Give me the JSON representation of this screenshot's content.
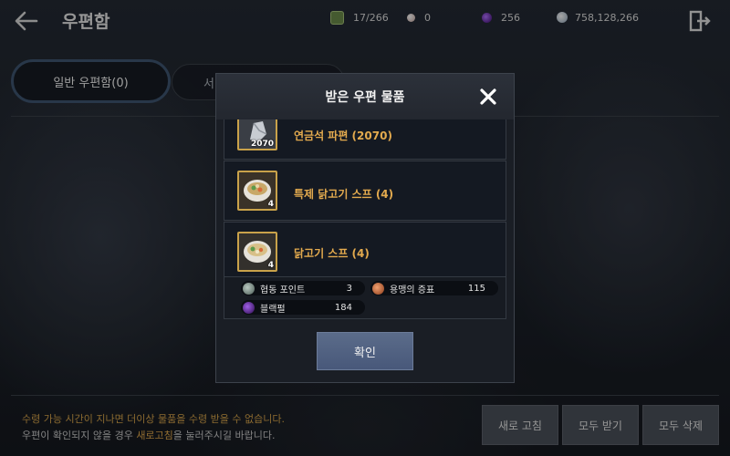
{
  "header": {
    "title": "우편함",
    "currencies": [
      {
        "icon": "coin-icon",
        "value": "17/266"
      },
      {
        "icon": "pearl-icon",
        "value": "0"
      },
      {
        "icon": "purple-orb-icon",
        "value": "256"
      },
      {
        "icon": "silver-icon",
        "value": "758,128,266"
      }
    ]
  },
  "tabs": [
    {
      "label": "일반 우편함(0)",
      "active": true
    },
    {
      "label": "서"
    }
  ],
  "modal": {
    "title": "받은 우편 물품",
    "items": [
      {
        "name": "연금석 파편 (2070)",
        "qty": "2070",
        "icon": "alchemy-stone-shard-icon"
      },
      {
        "name": "특제 닭고기 스프 (4)",
        "qty": "4",
        "icon": "soup-bowl-icon"
      },
      {
        "name": "닭고기 스프 (4)",
        "qty": "4",
        "icon": "soup-bowl-icon"
      }
    ],
    "rewards": [
      {
        "label": "협동 포인트",
        "value": "3",
        "icon": "cooperation-point-icon"
      },
      {
        "label": "용맹의 증표",
        "value": "115",
        "icon": "valor-token-icon"
      },
      {
        "label": "블랙펄",
        "value": "184",
        "icon": "black-pearl-icon"
      }
    ],
    "confirm_label": "확인"
  },
  "footer": {
    "note1": "수령 가능 시간이 지나면 더이상 물품을 수령 받을 수 없습니다.",
    "note2_pre": "우편이 확인되지 않을 경우 ",
    "note2_highlight": "새로고침",
    "note2_post": "을 눌러주시길 바랍니다.",
    "buttons": {
      "refresh": "새로 고침",
      "receive_all": "모두 받기",
      "delete_all": "모두 삭제"
    }
  },
  "colors": {
    "accent": "#e3aa4e",
    "item_border": "#c9a24a",
    "confirm_button": "#5b6c8a"
  }
}
